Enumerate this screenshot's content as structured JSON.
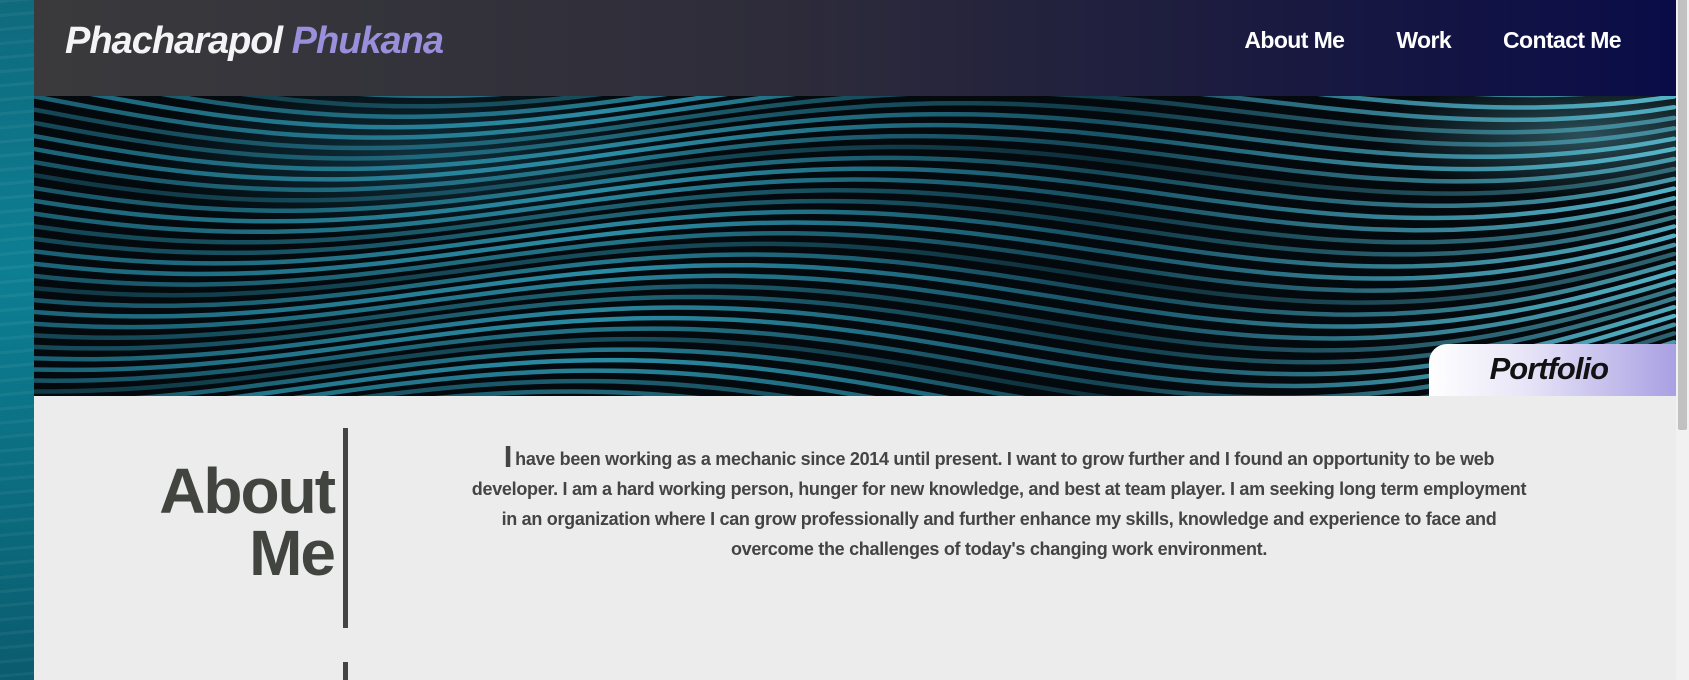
{
  "header": {
    "brand_first": "Phacharapol",
    "brand_last": "Phukana",
    "nav": [
      {
        "label": "About Me"
      },
      {
        "label": "Work"
      },
      {
        "label": "Contact Me"
      }
    ]
  },
  "hero": {
    "tab_label": "Portfolio"
  },
  "about": {
    "heading_line1": "About",
    "heading_line2": "Me",
    "text_first_letter": "I",
    "text_rest": "have been working as a mechanic since 2014 until present. I want to grow further and I found an opportunity to be web developer. I am a hard working person, hunger for new knowledge, and best at team player. I am seeking long term employment in an organization where I can grow professionally and further enhance my skills, knowledge and experience to face and overcome the challenges of today's changing work environment."
  },
  "colors": {
    "brand_accent": "#9a8fdb",
    "header_dark": "#3a3a3c",
    "header_navy": "#0a0c48",
    "page_bg": "#ececec",
    "text_dark": "#444444"
  }
}
